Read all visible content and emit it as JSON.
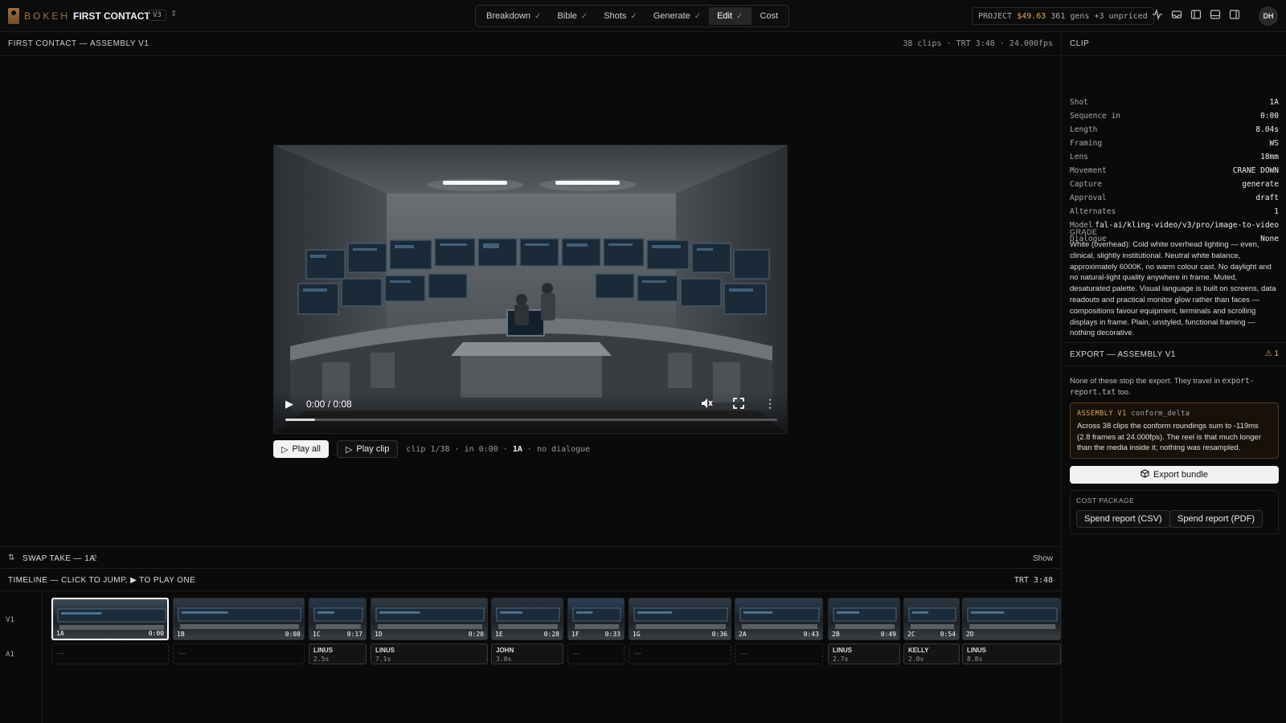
{
  "app": {
    "logo_text": "BOKEH",
    "project_title": "FIRST CONTACT",
    "version": "V3"
  },
  "tabs": [
    {
      "label": "Breakdown",
      "done": true
    },
    {
      "label": "Bible",
      "done": true
    },
    {
      "label": "Shots",
      "done": true
    },
    {
      "label": "Generate",
      "done": true
    },
    {
      "label": "Edit",
      "done": true,
      "active": true
    },
    {
      "label": "Cost",
      "done": false
    }
  ],
  "cost_chip": {
    "label": "PROJECT",
    "amount": "$49.63",
    "detail": "361 gens +3 unpriced"
  },
  "user": {
    "initials": "DH"
  },
  "assembly": {
    "title": "FIRST CONTACT — ASSEMBLY V1",
    "meta": "38 clips · TRT 3:48 · 24.000fps"
  },
  "player": {
    "time": "0:00 / 0:08",
    "progress_pct": 6
  },
  "play_row": {
    "play_all": "Play all",
    "play_clip": "Play clip",
    "clip_info_prefix": "clip 1/38 · in 0:00 ·",
    "clip_info_shot": "1A",
    "clip_info_suffix": "· no dialogue"
  },
  "swap": {
    "label": "SWAP TAKE — 1A",
    "count": "2",
    "show": "Show"
  },
  "timeline": {
    "title": "TIMELINE — CLICK TO JUMP, ▶ TO PLAY ONE",
    "trt": "TRT 3:48",
    "video_track": "V1",
    "audio_track": "A1",
    "clips": [
      {
        "tag": "1A",
        "time": "0:00"
      },
      {
        "tag": "1B",
        "time": "0:08"
      },
      {
        "tag": "1C",
        "time": "0:17"
      },
      {
        "tag": "1D",
        "time": "0:20"
      },
      {
        "tag": "1E",
        "time": "0:28"
      },
      {
        "tag": "1F",
        "time": "0:33"
      },
      {
        "tag": "1G",
        "time": "0:36"
      },
      {
        "tag": "2A",
        "time": "0:43"
      },
      {
        "tag": "2B",
        "time": "0:49"
      },
      {
        "tag": "2C",
        "time": "0:54"
      },
      {
        "tag": "2D",
        "time": ""
      }
    ],
    "audio": [
      {
        "empty": true,
        "dash": "—"
      },
      {
        "empty": true,
        "dash": "—"
      },
      {
        "empty": false,
        "name": "LINUS",
        "len": "2.5s"
      },
      {
        "empty": false,
        "name": "LINUS",
        "len": "7.1s"
      },
      {
        "empty": false,
        "name": "JOHN",
        "len": "3.0s"
      },
      {
        "empty": true,
        "dash": "—"
      },
      {
        "empty": true,
        "dash": "—"
      },
      {
        "empty": true,
        "dash": "—"
      },
      {
        "empty": false,
        "name": "LINUS",
        "len": "2.7s"
      },
      {
        "empty": false,
        "name": "KELLY",
        "len": "2.0s"
      },
      {
        "empty": false,
        "name": "LINUS",
        "len": "8.8s"
      }
    ]
  },
  "clip_panel": {
    "title": "CLIP",
    "fields": [
      {
        "k": "Shot",
        "v": "1A"
      },
      {
        "k": "Sequence in",
        "v": "0:00"
      },
      {
        "k": "Length",
        "v": "8.04s"
      },
      {
        "k": "Framing",
        "v": "WS"
      },
      {
        "k": "Lens",
        "v": "18mm"
      },
      {
        "k": "Movement",
        "v": "CRANE DOWN"
      },
      {
        "k": "Capture",
        "v": "generate"
      },
      {
        "k": "Approval",
        "v": "draft"
      },
      {
        "k": "Alternates",
        "v": "1"
      },
      {
        "k": "Model",
        "v": "fal-ai/kling-video/v3/pro/image-to-video"
      },
      {
        "k": "Dialogue",
        "v": "None"
      }
    ],
    "grade_label": "GRADE",
    "grade_text": "White (overhead): Cold white overhead lighting — even, clinical, slightly institutional. Neutral white balance, approximately 6000K, no warm colour cast. No daylight and no natural-light quality anywhere in frame. Muted, desaturated palette. Visual language is built on screens, data readouts and practical monitor glow rather than faces — compositions favour equipment, terminals and scrolling displays in frame. Plain, unstyled, functional framing — nothing decorative."
  },
  "export": {
    "title": "EXPORT — ASSEMBLY V1",
    "warn_count": "1",
    "note_a": "None of these stop the export. They travel in",
    "note_file": "export-report.txt",
    "note_b": "too.",
    "warn_head": "ASSEMBLY V1",
    "warn_code": "conform_delta",
    "warn_body": "Across 38 clips the conform roundings sum to -119ms (2.8 frames at 24.000fps). The reel is that much longer than the media inside it; nothing was resampled.",
    "export_btn": "Export bundle",
    "cost_package_label": "COST PACKAGE",
    "csv_btn": "Spend report (CSV)",
    "pdf_btn": "Spend report (PDF)"
  },
  "colors": {
    "accent": "#e0a85a",
    "brand": "#a0723f",
    "bg": "#0a0a0a"
  }
}
